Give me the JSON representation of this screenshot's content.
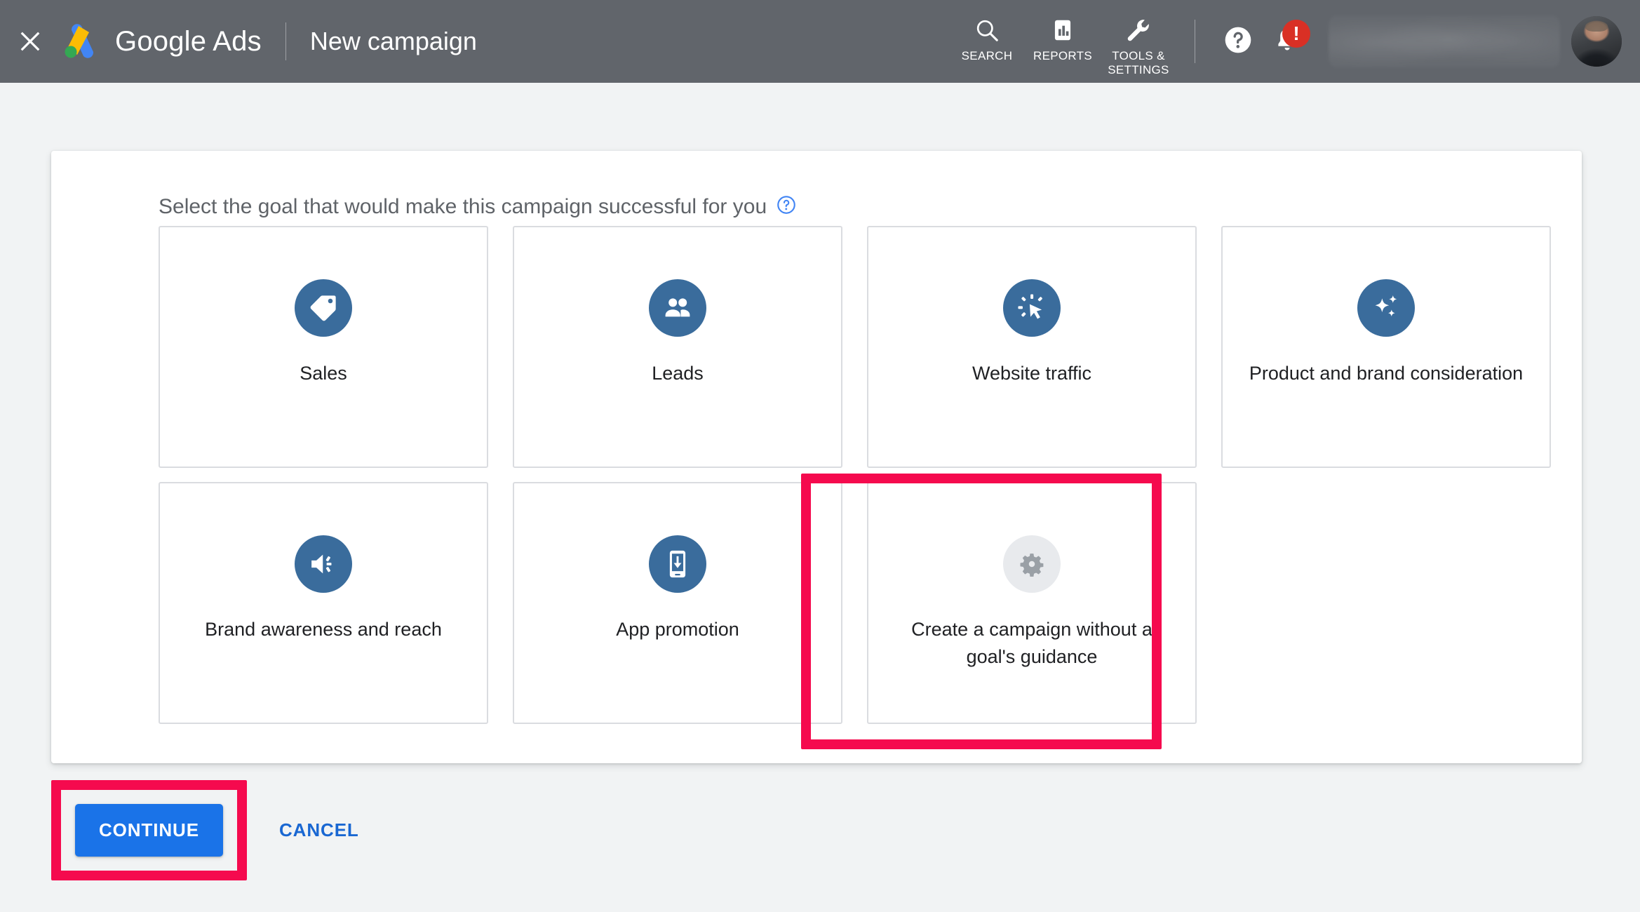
{
  "header": {
    "close_icon": "close-icon",
    "brand_logo_icon": "google-ads-logo-icon",
    "brand_name": "Google Ads",
    "page_title": "New campaign",
    "tools": [
      {
        "icon": "search-icon",
        "label": "SEARCH"
      },
      {
        "icon": "reports-icon",
        "label": "REPORTS"
      },
      {
        "icon": "wrench-icon",
        "label": "TOOLS &\nSETTINGS"
      }
    ],
    "help_button_icon": "help-circle-icon",
    "notifications_icon": "bell-icon",
    "notification_badge": "!",
    "account_name": "",
    "avatar_icon": "user-avatar"
  },
  "main": {
    "prompt": "Select the goal that would make this campaign successful for you",
    "prompt_help_icon": "help-circle-outline-icon",
    "goals": [
      {
        "label": "Sales",
        "icon": "price-tag-icon",
        "style": "blue"
      },
      {
        "label": "Leads",
        "icon": "people-icon",
        "style": "blue"
      },
      {
        "label": "Website traffic",
        "icon": "click-cursor-icon",
        "style": "blue"
      },
      {
        "label": "Product and brand consideration",
        "icon": "sparkles-icon",
        "style": "blue"
      },
      {
        "label": "Brand awareness and reach",
        "icon": "speaker-icon",
        "style": "blue"
      },
      {
        "label": "App promotion",
        "icon": "phone-download-icon",
        "style": "blue"
      },
      {
        "label": "Create a campaign without a goal's guidance",
        "icon": "gear-icon",
        "style": "neutral"
      }
    ]
  },
  "footer": {
    "continue_label": "CONTINUE",
    "cancel_label": "CANCEL"
  },
  "colors": {
    "header_bg": "#61656b",
    "page_bg": "#f1f3f4",
    "goal_icon_blue": "#3a6c9c",
    "goal_icon_neutral": "#e8eaed",
    "primary_button": "#1a73e8",
    "link_blue": "#1967d2",
    "annotation_pink": "#f50a4e",
    "badge_red": "#d93025",
    "card_border": "#dadce0"
  }
}
